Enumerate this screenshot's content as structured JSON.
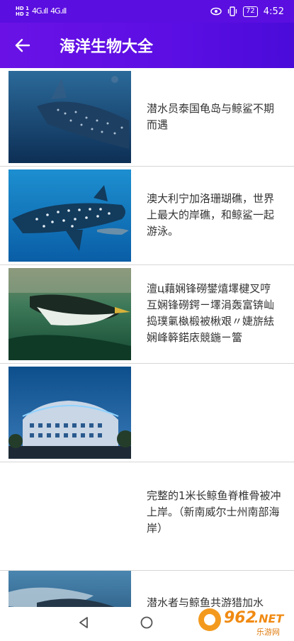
{
  "statusbar": {
    "hd1": "HD 1",
    "hd2": "HD 2",
    "sig1": "4G.ıll",
    "sig2": "4G.ıll",
    "battery": "72",
    "time": "4:52"
  },
  "appbar": {
    "title": "海洋生物大全"
  },
  "items": [
    {
      "text": "潜水员泰国龟岛与鲸鲨不期而遇",
      "image": "whale-shark-photo"
    },
    {
      "text": "澳大利宁加洛珊瑚礁，世界上最大的岸礁，和鲸鲨一起游泳。",
      "image": "whale-shark-reef-photo"
    },
    {
      "text": "澶ц藉娴锋磱鐢熺墿楗叉哼互娴锋磱鍔ㄧ墿涓轰富锛屾捣璞氭槸椴被楸艰〃婕旂紶娴峰簳鍩庡競鍦ㄧ簹",
      "image": "penguin-aquarium-photo"
    },
    {
      "text": "",
      "image": "ocean-park-hotel-photo"
    },
    {
      "text": "完整的1米长鲸鱼脊椎骨被冲上岸。（新南威尔士州南部海岸）",
      "image": ""
    },
    {
      "text": "潜水者与鲸鱼共游猎加水",
      "image": "diver-whale-photo"
    }
  ],
  "watermark": {
    "brand": "962.NET",
    "sub": "乐游网"
  }
}
